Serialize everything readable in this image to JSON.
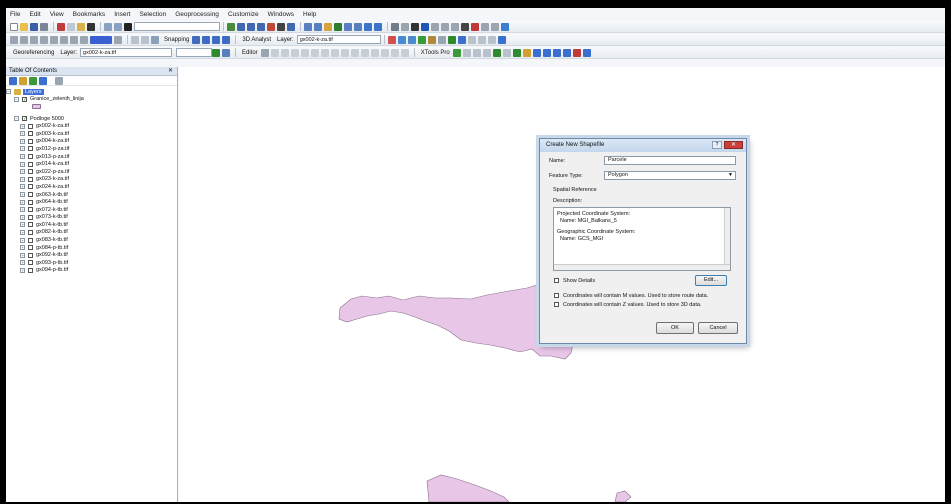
{
  "menu": [
    "File",
    "Edit",
    "View",
    "Bookmarks",
    "Insert",
    "Selection",
    "Geoprocessing",
    "Customize",
    "Windows",
    "Help"
  ],
  "toolbar": {
    "snapping_label": "Snapping",
    "analyst_label": "3D Analyst",
    "layer_label": "Layer:",
    "layer_value": "gx002-k-za.tif",
    "georef_label": "Georeferencing",
    "georef_layer_label": "Layer:",
    "georef_layer_value": "gx002-k-za.tif",
    "editor_label": "Editor",
    "xtools_label": "XTools Pro"
  },
  "toc": {
    "title": "Table Of Contents",
    "close": "✕",
    "root": "Layers",
    "group1": "Granice_zelenih_linija",
    "group2": "Podloge 5000",
    "layers": [
      "gx002-k-za.tif",
      "gx003-k-za.tif",
      "gx004-k-za.tif",
      "gx012-p-za.tif",
      "gx013-p-za.tif",
      "gx014-k-za.tif",
      "gx022-p-za.tif",
      "gx023-k-za.tif",
      "gx024-k-za.tif",
      "gx063-k-tb.tif",
      "gx064-k-tb.tif",
      "gx072-k-tb.tif",
      "gx073-k-tb.tif",
      "gx074-k-tb.tif",
      "gx082-k-tb.tif",
      "gx083-k-tb.tif",
      "gx084-p-tb.tif",
      "gx092-k-tb.tif",
      "gx093-p-tb.tif",
      "gx094-p-tb.tif"
    ]
  },
  "dialog": {
    "title": "Create New Shapefile",
    "help": "?",
    "close": "✕",
    "name_label": "Name:",
    "name_value": "Parcele",
    "type_label": "Feature Type:",
    "type_value": "Polygon",
    "spatial_label": "Spatial Reference",
    "desc_label": "Description:",
    "desc_line1": "Projected Coordinate System:",
    "desc_line2": "Name: MGI_Balkans_5",
    "desc_line3": "Geographic Coordinate System:",
    "desc_line4": "Name: GCS_MGI",
    "show_details": "Show Details",
    "edit": "Edit...",
    "m_values": "Coordinates will contain M values. Used to store route data.",
    "z_values": "Coordinates will contain Z values. Used to store 3D data.",
    "ok": "OK",
    "cancel": "Cancel"
  },
  "colors": {
    "polygon_fill": "#e8c6e8",
    "polygon_stroke": "#8a6f8a",
    "selection": "#3d6fd6"
  }
}
